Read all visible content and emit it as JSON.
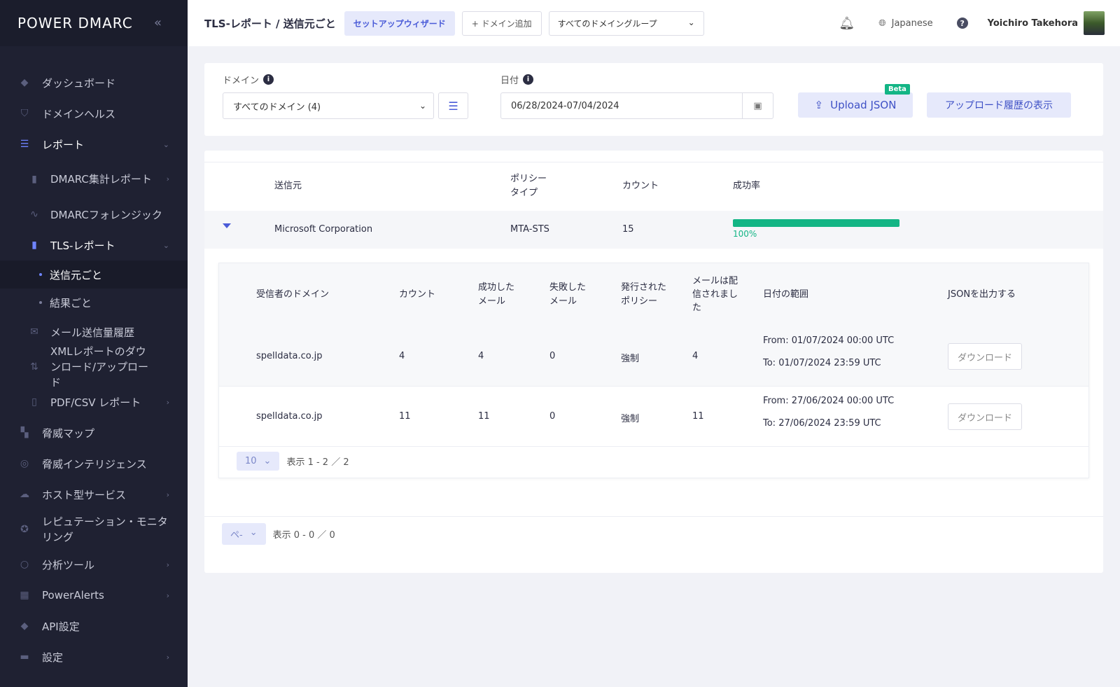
{
  "brand": {
    "logo": "POWER DMARC",
    "collapse_icon": "double-chevron-left-icon"
  },
  "sidebar": {
    "items": [
      {
        "label": "ダッシュボード",
        "icon": "dashboard-icon"
      },
      {
        "label": "ドメインヘルス",
        "icon": "shield-icon"
      },
      {
        "label": "レポート",
        "icon": "report-icon"
      },
      {
        "label": "DMARC集計レポート",
        "icon": "bar-chart-icon"
      },
      {
        "label": "DMARCフォレンジック",
        "icon": "pulse-icon"
      },
      {
        "label": "TLS-レポート",
        "icon": "bar-chart-icon"
      },
      {
        "label": "送信元ごと"
      },
      {
        "label": "結果ごと"
      },
      {
        "label": "メール送信量履歴",
        "icon": "mail-icon"
      },
      {
        "label": "XMLレポートのダウンロード/アップロード",
        "icon": "transfer-icon"
      },
      {
        "label": "PDF/CSV レポート",
        "icon": "file-icon"
      },
      {
        "label": "脅威マップ",
        "icon": "map-icon"
      },
      {
        "label": "脅威インテリジェンス",
        "icon": "radar-icon"
      },
      {
        "label": "ホスト型サービス",
        "icon": "cloud-icon"
      },
      {
        "label": "レピュテーション・モニタリング",
        "icon": "badge-icon"
      },
      {
        "label": "分析ツール",
        "icon": "search-icon"
      },
      {
        "label": "PowerAlerts",
        "icon": "grid-icon"
      },
      {
        "label": "API設定",
        "icon": "api-icon"
      },
      {
        "label": "設定",
        "icon": "toggle-icon"
      }
    ]
  },
  "header": {
    "breadcrumb": "TLS-レポート / 送信元ごと",
    "wizard": "セットアップウィザード",
    "add_domain": "ドメイン追加",
    "domain_group": "すべてのドメイングループ",
    "language": "Japanese",
    "user": "Yoichiro Takehora"
  },
  "filters": {
    "domain_label": "ドメイン",
    "domain_value": "すべてのドメイン (4)",
    "date_label": "日付",
    "date_value": "06/28/2024-07/04/2024",
    "upload": "Upload JSON",
    "beta": "Beta",
    "history": "アップロード履歴の表示"
  },
  "table": {
    "headers": {
      "sender": "送信元",
      "policy_l1": "ポリシー",
      "policy_l2": "タイプ",
      "count": "カウント",
      "success": "成功率"
    },
    "row": {
      "sender": "Microsoft Corporation",
      "policy": "MTA-STS",
      "count": "15",
      "success_label": "100%",
      "success_fraction": 1.0
    },
    "inner_headers": {
      "domain": "受信者のドメイン",
      "count": "カウント",
      "ok_l1": "成功した",
      "ok_l2": "メール",
      "fail_l1": "失敗した",
      "fail_l2": "メール",
      "pol_l1": "発行された",
      "pol_l2": "ポリシー",
      "deliv_l1": "メールは配",
      "deliv_l2": "信されまし",
      "deliv_l3": "た",
      "range": "日付の範囲",
      "json": "JSONを出力する"
    },
    "inner_rows": [
      {
        "domain": "spelldata.co.jp",
        "count": "4",
        "ok": "4",
        "fail": "0",
        "policy": "強制",
        "delivered": "4",
        "from": "From: 01/07/2024 00:00 UTC",
        "to": "To: 01/07/2024 23:59 UTC",
        "action": "ダウンロード"
      },
      {
        "domain": "spelldata.co.jp",
        "count": "11",
        "ok": "11",
        "fail": "0",
        "policy": "強制",
        "delivered": "11",
        "from": "From: 27/06/2024 00:00 UTC",
        "to": "To: 27/06/2024 23:59 UTC",
        "action": "ダウンロード"
      }
    ],
    "inner_pager": {
      "size": "10",
      "info": "表示 1 - 2 ／ 2"
    },
    "outer_pager": {
      "size": "ペ-",
      "info": "表示 0 - 0 ／ 0"
    }
  }
}
